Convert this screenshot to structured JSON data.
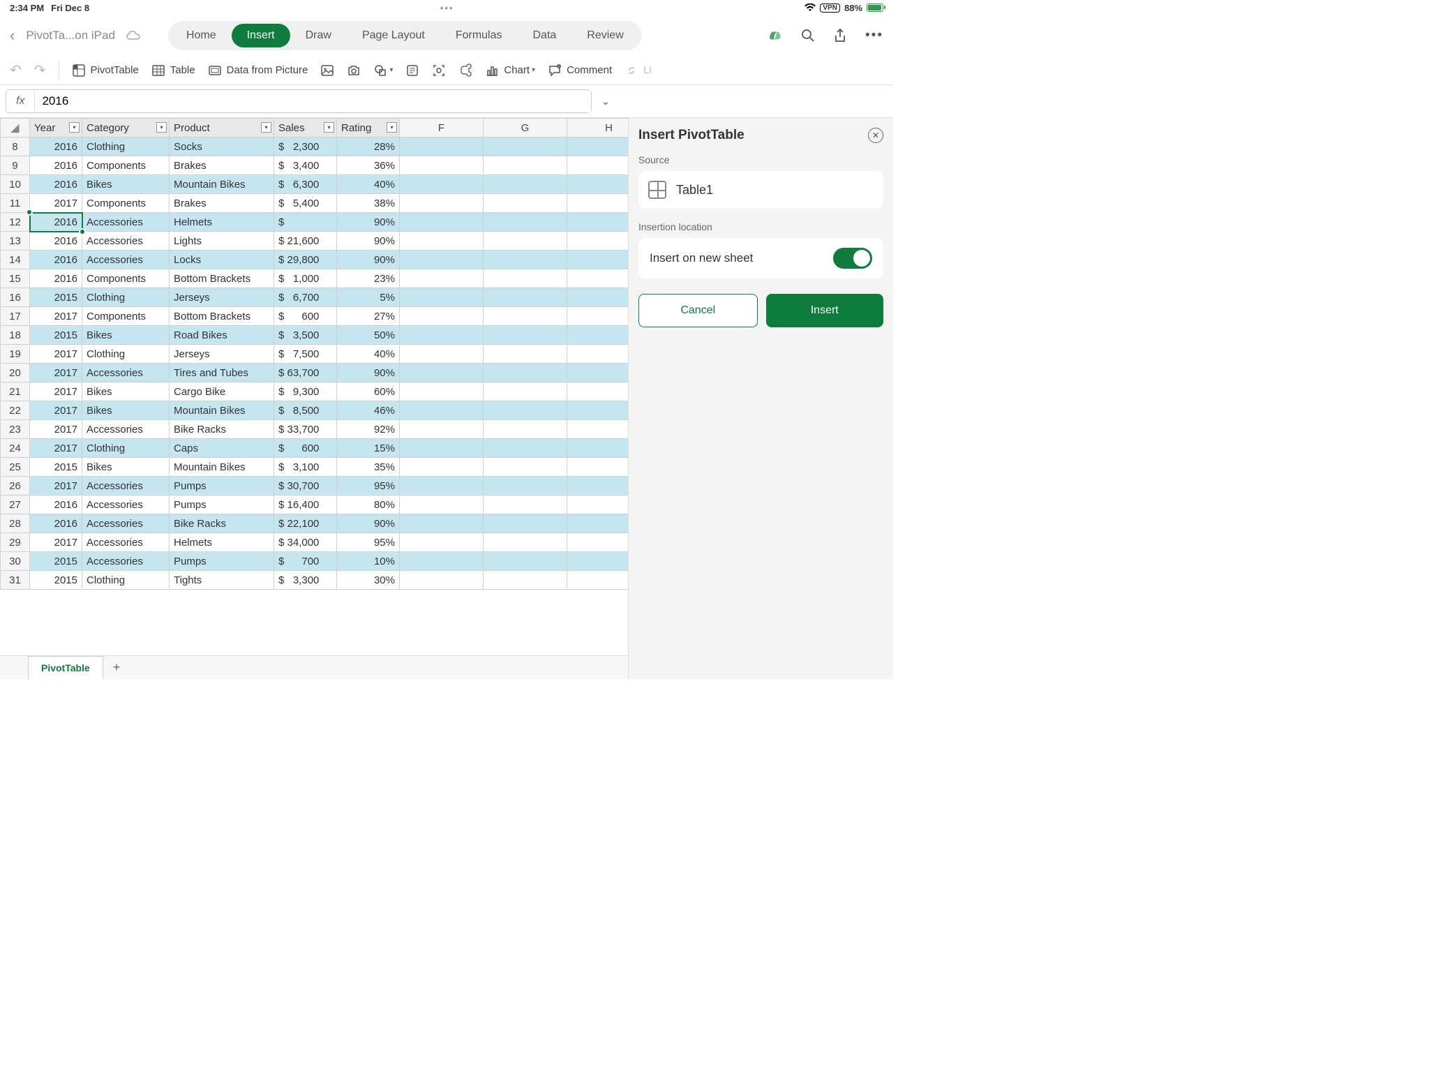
{
  "status": {
    "time": "2:34 PM",
    "date": "Fri Dec 8",
    "vpn": "VPN",
    "battery": "88%"
  },
  "titlebar": {
    "doc_name": "PivotTa...on iPad",
    "tabs": [
      "Home",
      "Insert",
      "Draw",
      "Page Layout",
      "Formulas",
      "Data",
      "Review"
    ],
    "active_tab": 1
  },
  "toolbar": {
    "pivot": "PivotTable",
    "table": "Table",
    "picture": "Data from Picture",
    "chart": "Chart",
    "comment": "Comment",
    "link": "Link"
  },
  "formula": {
    "fx": "fx",
    "value": "2016"
  },
  "columns": {
    "headers": [
      "Year",
      "Category",
      "Product",
      "Sales",
      "Rating"
    ],
    "extra": [
      "F",
      "G",
      "H"
    ],
    "widths": [
      75,
      125,
      150,
      90,
      90
    ]
  },
  "selected_row": 12,
  "rows": [
    {
      "n": 8,
      "year": "2016",
      "cat": "Clothing",
      "prod": "Socks",
      "sales": "$   2,300",
      "rating": "28%"
    },
    {
      "n": 9,
      "year": "2016",
      "cat": "Components",
      "prod": "Brakes",
      "sales": "$   3,400",
      "rating": "36%"
    },
    {
      "n": 10,
      "year": "2016",
      "cat": "Bikes",
      "prod": "Mountain Bikes",
      "sales": "$   6,300",
      "rating": "40%"
    },
    {
      "n": 11,
      "year": "2017",
      "cat": "Components",
      "prod": "Brakes",
      "sales": "$   5,400",
      "rating": "38%"
    },
    {
      "n": 12,
      "year": "2016",
      "cat": "Accessories",
      "prod": "Helmets",
      "sales": "$",
      "rating": "90%"
    },
    {
      "n": 13,
      "year": "2016",
      "cat": "Accessories",
      "prod": "Lights",
      "sales": "$ 21,600",
      "rating": "90%"
    },
    {
      "n": 14,
      "year": "2016",
      "cat": "Accessories",
      "prod": "Locks",
      "sales": "$ 29,800",
      "rating": "90%"
    },
    {
      "n": 15,
      "year": "2016",
      "cat": "Components",
      "prod": "Bottom Brackets",
      "sales": "$   1,000",
      "rating": "23%"
    },
    {
      "n": 16,
      "year": "2015",
      "cat": "Clothing",
      "prod": "Jerseys",
      "sales": "$   6,700",
      "rating": "5%"
    },
    {
      "n": 17,
      "year": "2017",
      "cat": "Components",
      "prod": "Bottom Brackets",
      "sales": "$      600",
      "rating": "27%"
    },
    {
      "n": 18,
      "year": "2015",
      "cat": "Bikes",
      "prod": "Road Bikes",
      "sales": "$   3,500",
      "rating": "50%"
    },
    {
      "n": 19,
      "year": "2017",
      "cat": "Clothing",
      "prod": "Jerseys",
      "sales": "$   7,500",
      "rating": "40%"
    },
    {
      "n": 20,
      "year": "2017",
      "cat": "Accessories",
      "prod": "Tires and Tubes",
      "sales": "$ 63,700",
      "rating": "90%"
    },
    {
      "n": 21,
      "year": "2017",
      "cat": "Bikes",
      "prod": "Cargo Bike",
      "sales": "$   9,300",
      "rating": "60%"
    },
    {
      "n": 22,
      "year": "2017",
      "cat": "Bikes",
      "prod": "Mountain Bikes",
      "sales": "$   8,500",
      "rating": "46%"
    },
    {
      "n": 23,
      "year": "2017",
      "cat": "Accessories",
      "prod": "Bike Racks",
      "sales": "$ 33,700",
      "rating": "92%"
    },
    {
      "n": 24,
      "year": "2017",
      "cat": "Clothing",
      "prod": "Caps",
      "sales": "$      600",
      "rating": "15%"
    },
    {
      "n": 25,
      "year": "2015",
      "cat": "Bikes",
      "prod": "Mountain Bikes",
      "sales": "$   3,100",
      "rating": "35%"
    },
    {
      "n": 26,
      "year": "2017",
      "cat": "Accessories",
      "prod": "Pumps",
      "sales": "$ 30,700",
      "rating": "95%"
    },
    {
      "n": 27,
      "year": "2016",
      "cat": "Accessories",
      "prod": "Pumps",
      "sales": "$ 16,400",
      "rating": "80%"
    },
    {
      "n": 28,
      "year": "2016",
      "cat": "Accessories",
      "prod": "Bike Racks",
      "sales": "$ 22,100",
      "rating": "90%"
    },
    {
      "n": 29,
      "year": "2017",
      "cat": "Accessories",
      "prod": "Helmets",
      "sales": "$ 34,000",
      "rating": "95%"
    },
    {
      "n": 30,
      "year": "2015",
      "cat": "Accessories",
      "prod": "Pumps",
      "sales": "$      700",
      "rating": "10%"
    },
    {
      "n": 31,
      "year": "2015",
      "cat": "Clothing",
      "prod": "Tights",
      "sales": "$   3,300",
      "rating": "30%"
    }
  ],
  "panel": {
    "title": "Insert PivotTable",
    "source_label": "Source",
    "source_name": "Table1",
    "loc_label": "Insertion location",
    "insert_new": "Insert on new sheet",
    "cancel": "Cancel",
    "insert": "Insert"
  },
  "sheet_tab": "PivotTable"
}
